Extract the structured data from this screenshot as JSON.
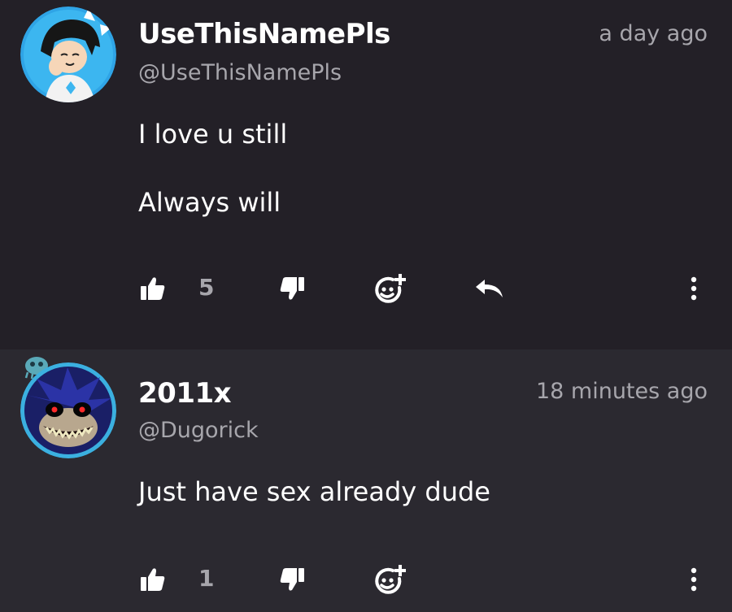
{
  "comments": [
    {
      "username": "UseThisNamePls",
      "handle": "@UseThisNamePls",
      "timestamp": "a day ago",
      "body": [
        "I love u still",
        "Always will"
      ],
      "likes": "5",
      "icons": [
        "avatar-cartoon",
        "thumbs-up-icon",
        "thumbs-down-icon",
        "emoji-add-icon",
        "reply-icon",
        "more-vertical-icon"
      ]
    },
    {
      "username": "2011x",
      "handle": "@Dugorick",
      "timestamp": "18 minutes ago",
      "body": [
        "Just have sex already dude"
      ],
      "likes": "1",
      "icons": [
        "avatar-sonic-exe",
        "thumbs-up-icon",
        "thumbs-down-icon",
        "emoji-add-icon",
        "more-vertical-icon"
      ]
    }
  ],
  "colors": {
    "background": "#232027",
    "second_comment_background": "#2b2930",
    "text_primary": "#ffffff",
    "text_secondary": "#a7a6ac",
    "avatar_ring": "#3bb0e0"
  }
}
